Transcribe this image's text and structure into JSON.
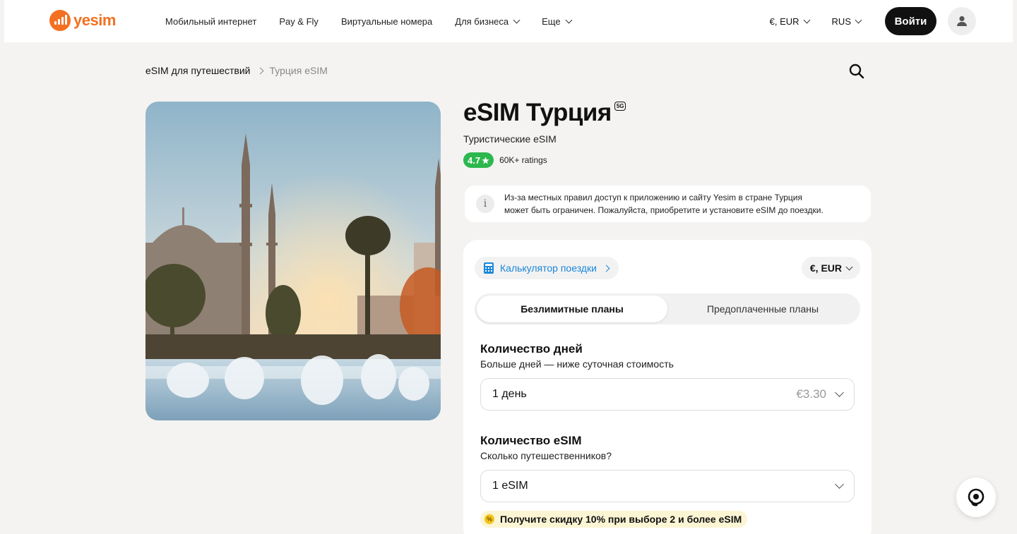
{
  "header": {
    "logo_text": "yesim",
    "nav": [
      {
        "label": "Мобильный интернет",
        "dropdown": false
      },
      {
        "label": "Pay & Fly",
        "dropdown": false
      },
      {
        "label": "Виртуальные номера",
        "dropdown": false
      },
      {
        "label": "Для бизнеса",
        "dropdown": true
      },
      {
        "label": "Еще",
        "dropdown": true
      }
    ],
    "currency": "€, EUR",
    "language": "RUS",
    "login_label": "Войти"
  },
  "breadcrumb": {
    "parent": "eSIM для путешествий",
    "current": "Турция eSIM"
  },
  "product": {
    "title": "eSIM Турция",
    "network_badge": "5G",
    "subtitle": "Туристические eSIM",
    "rating": "4.7",
    "rating_count": "60K+ ratings",
    "notice_line1": "Из-за местных правил доступ к приложению и сайту Yesim в стране Турция",
    "notice_line2": "может быть ограничен. Пожалуйста, приобретите и установите eSIM до поездки."
  },
  "card": {
    "calculator_label": "Калькулятор поездки",
    "currency_label": "€, EUR",
    "tabs": [
      "Безлимитные планы",
      "Предоплаченные планы"
    ],
    "active_tab": 0,
    "days_title": "Количество дней",
    "days_sub": "Больше дней — ниже суточная стоимость",
    "days_value": "1 день",
    "days_price": "€3.30",
    "esim_title": "Количество eSIM",
    "esim_sub": "Сколько путешественников?",
    "esim_value": "1 eSIM",
    "promo": "Получите скидку 10% при выборе 2 и более eSIM"
  },
  "colors": {
    "brand": "#f37021",
    "rating": "#2db84d",
    "link": "#1a86d9",
    "background": "#f4f3f1"
  },
  "icons": [
    "logo-icon",
    "chevron-down-icon",
    "user-icon",
    "search-icon",
    "info-icon",
    "calculator-icon",
    "chevron-right-icon",
    "star-icon",
    "support-chat-icon",
    "discount-icon"
  ]
}
